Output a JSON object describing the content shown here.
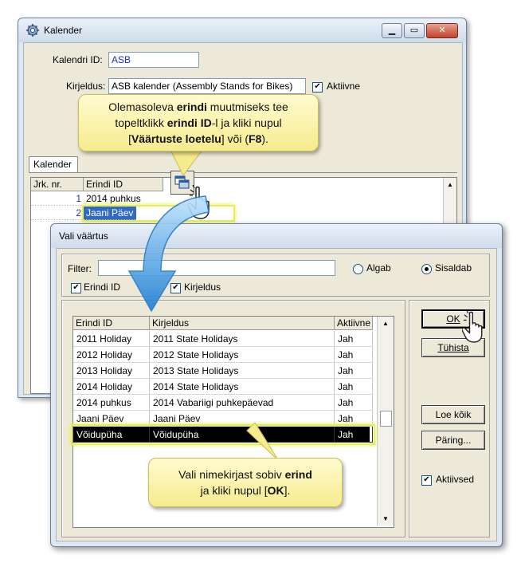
{
  "kalender_window": {
    "title": "Kalender",
    "kalendri_id_label": "Kalendri ID:",
    "kalendri_id_value": "ASB",
    "kirjeldus_label": "Kirjeldus:",
    "kirjeldus_value": "ASB kalender (Assembly Stands for Bikes)",
    "aktiivne_label": "Aktiivne",
    "aktiivne_checked": true,
    "tab_label": "Kalender",
    "grid_headers": [
      "Jrk. nr.",
      "Erindi ID"
    ],
    "grid_rows": [
      {
        "nr": "1",
        "id": "2014 puhkus"
      },
      {
        "nr": "2",
        "id": "Jaani Päev"
      }
    ]
  },
  "callout_top": {
    "line1_a": "Olemasoleva ",
    "line1_b": "erindi",
    "line1_c": " muutmiseks tee",
    "line2_a": "topeltklikk ",
    "line2_b": "erindi ID",
    "line2_c": "-l ja kliki nupul",
    "line3_a": "[",
    "line3_b": "Väärtuste loetelu",
    "line3_c": "] või (",
    "line3_d": "F8",
    "line3_e": ")."
  },
  "dialog": {
    "title": "Vali väärtus",
    "filter_label": "Filter:",
    "filter_value": "",
    "radio_algab": "Algab",
    "radio_sisaldab": "Sisaldab",
    "selected_radio": "Sisaldab",
    "chk_erindi_id": "Erindi ID",
    "chk_kirjeldus": "Kirjeldus",
    "headers": [
      "Erindi ID",
      "Kirjeldus",
      "Aktiivne"
    ],
    "rows": [
      {
        "id": "2011 Holiday",
        "desc": "2011 State Holidays",
        "active": "Jah"
      },
      {
        "id": "2012 Holiday",
        "desc": "2012 State Holidays",
        "active": "Jah"
      },
      {
        "id": "2013 Holiday",
        "desc": "2013 State Holidays",
        "active": "Jah"
      },
      {
        "id": "2014 Holiday",
        "desc": "2014 State Holidays",
        "active": "Jah"
      },
      {
        "id": "2014 puhkus",
        "desc": "2014 Vabariigi puhkepäevad",
        "active": "Jah"
      },
      {
        "id": "Jaani Päev",
        "desc": "Jaani Päev",
        "active": "Jah"
      },
      {
        "id": "Võidupüha",
        "desc": "Võidupüha",
        "active": "Jah"
      }
    ],
    "ok_label": "OK",
    "tuhista_label": "Tühista",
    "loe_koik_label": "Loe kõik",
    "paring_label": "Päring...",
    "aktiivsed_label": "Aktiivsed"
  },
  "callout_bottom": {
    "line1_a": "Vali nimekirjast sobiv ",
    "line1_b": "erind",
    "line2_a": "ja kliki nupul [",
    "line2_b": "OK",
    "line2_c": "]."
  },
  "colors": {
    "selection_highlight": "#e7f05a",
    "callout_fill": "#f9f1a8",
    "arrow": "#3d9be0"
  }
}
